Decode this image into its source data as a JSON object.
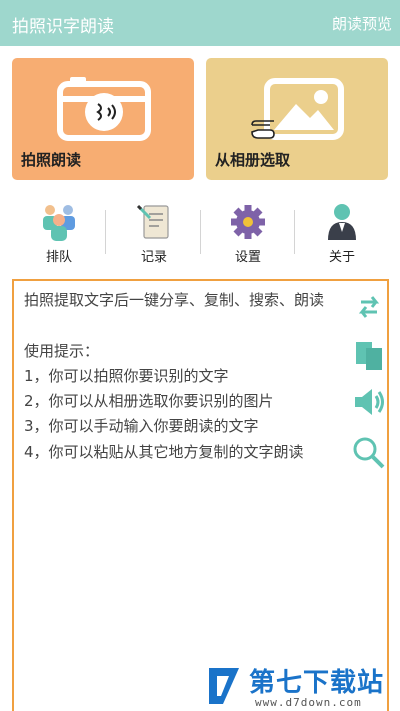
{
  "header": {
    "title": "拍照识字朗读",
    "preview_label": "朗读预览"
  },
  "cards": {
    "camera": {
      "label": "拍照朗读",
      "icon": "camera-icon"
    },
    "album": {
      "label": "从相册选取",
      "icon": "image-icon"
    }
  },
  "nav": [
    {
      "label": "排队",
      "icon": "people-icon"
    },
    {
      "label": "记录",
      "icon": "record-icon"
    },
    {
      "label": "设置",
      "icon": "gear-icon"
    },
    {
      "label": "关于",
      "icon": "person-icon"
    }
  ],
  "text": {
    "intro": "拍照提取文字后一键分享、复制、搜索、朗读",
    "tips_title": "使用提示：",
    "tips": [
      "1，你可以拍照你要识别的文字",
      "2，你可以从相册选取你要识别的图片",
      "3，你可以手动输入你要朗读的文字",
      "4，你可以粘贴从其它地方复制的文字朗读"
    ]
  },
  "side_actions": [
    {
      "icon": "share-icon"
    },
    {
      "icon": "copy-icon"
    },
    {
      "icon": "speaker-icon"
    },
    {
      "icon": "search-icon"
    }
  ],
  "watermark": {
    "brand": "第七下载站",
    "url": "www.d7down.com"
  },
  "colors": {
    "header": "#9ed7cd",
    "camera_card": "#f7ad72",
    "album_card": "#ebcf8c",
    "text_border": "#f0a040",
    "icon_teal": "#5fc3b2",
    "watermark_blue": "#1a73c9"
  }
}
